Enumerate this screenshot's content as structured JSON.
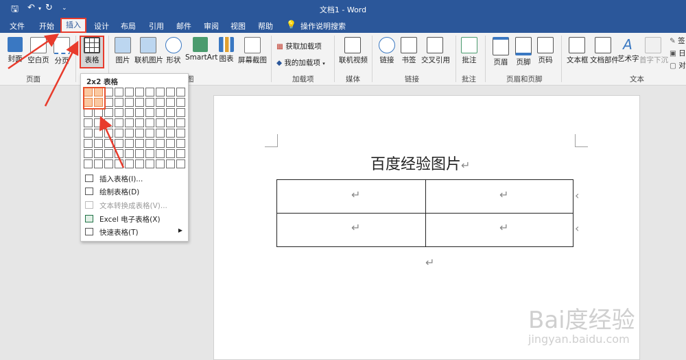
{
  "titlebar": {
    "title": "文档1  -  Word"
  },
  "tabs": [
    "文件",
    "开始",
    "插入",
    "设计",
    "布局",
    "引用",
    "邮件",
    "审阅",
    "视图",
    "帮助",
    "操作说明搜索"
  ],
  "ribbon": {
    "buttons": [
      "封面",
      "空白页",
      "分页",
      "表格",
      "图片",
      "联机图片",
      "形状",
      "SmartArt",
      "图表",
      "屏幕截图",
      "获取加载项",
      "我的加载项",
      "联机视频",
      "链接",
      "书签",
      "交叉引用",
      "批注",
      "页眉",
      "页脚",
      "页码",
      "文本框",
      "文档部件",
      "艺术字",
      "首字下沉"
    ],
    "groups": [
      "页面",
      "图",
      "加载项",
      "媒体",
      "链接",
      "批注",
      "页眉和页脚",
      "文本"
    ],
    "right_partial": [
      "签",
      "日",
      "对"
    ]
  },
  "table_menu": {
    "grid_label": "2x2 表格",
    "grid_cols": 10,
    "grid_rows": 8,
    "selected": [
      2,
      2
    ],
    "items": [
      {
        "label": "插入表格(I)...",
        "icon": "table-icon",
        "enabled": true
      },
      {
        "label": "绘制表格(D)",
        "icon": "pencil-table-icon",
        "enabled": true
      },
      {
        "label": "文本转换成表格(V)...",
        "icon": "convert-icon",
        "enabled": false
      },
      {
        "label": "Excel 电子表格(X)",
        "icon": "excel-icon",
        "enabled": true
      },
      {
        "label": "快速表格(T)",
        "icon": "quick-table-icon",
        "enabled": true,
        "submenu": true
      }
    ]
  },
  "document": {
    "heading": "百度经验图片",
    "paragraph_mark": "↵",
    "table_rows": 2,
    "table_cols": 2
  },
  "watermark": {
    "text": "Bai度经验",
    "url": "jingyan.baidu.com"
  },
  "colors": {
    "accent": "#2b579a",
    "annotation": "#e83b2c"
  }
}
